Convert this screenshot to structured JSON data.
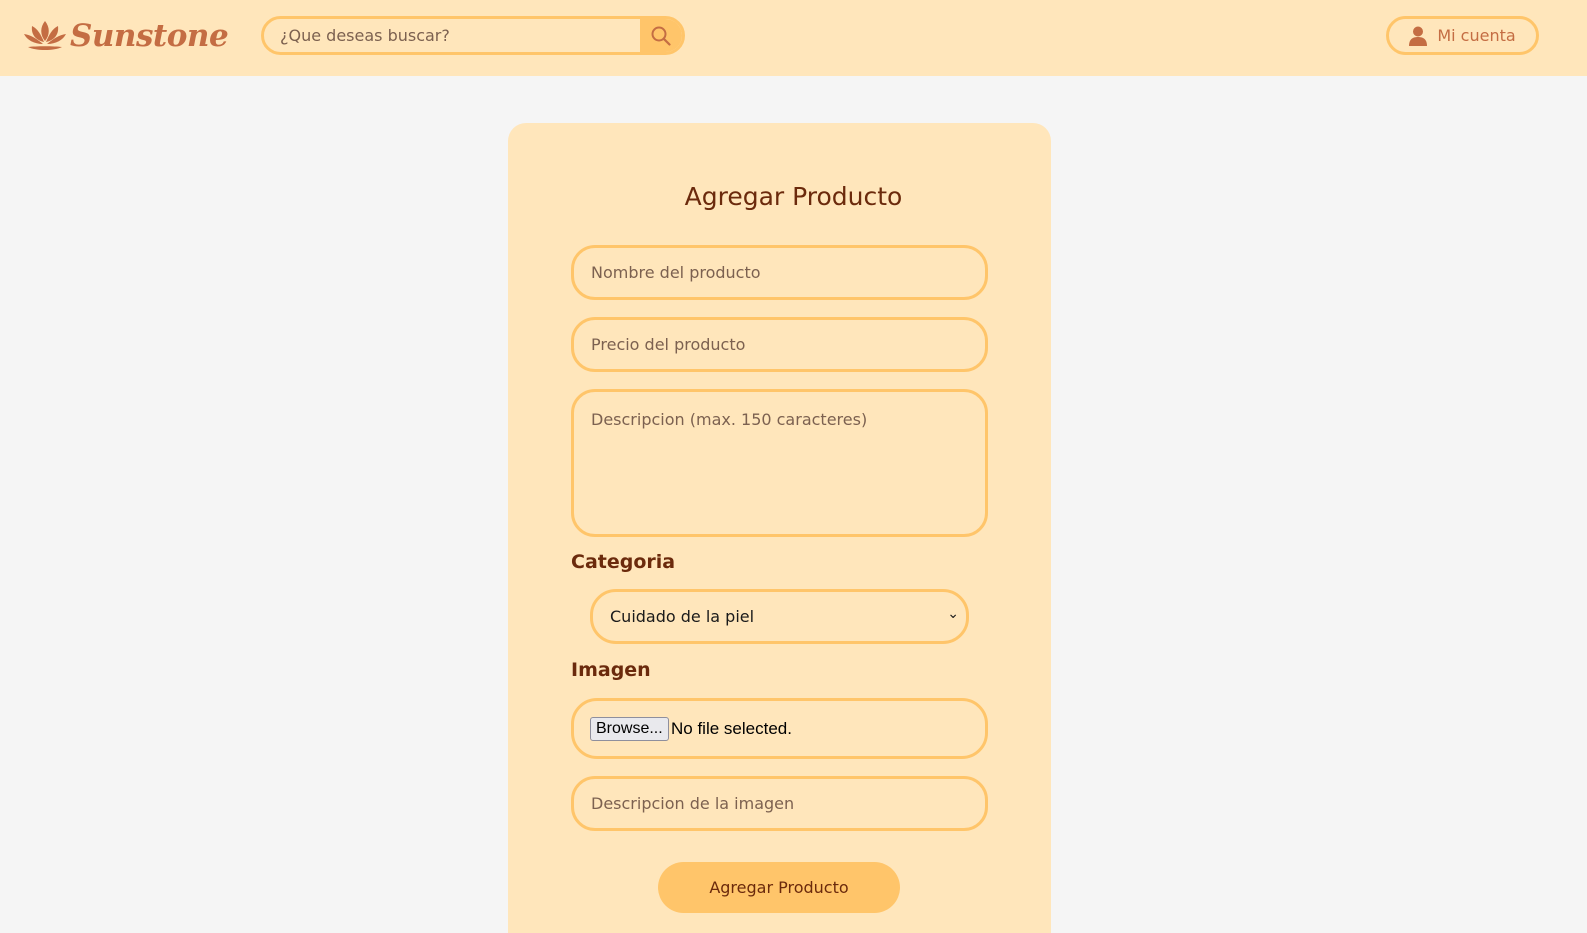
{
  "header": {
    "logo_text": "Sunstone",
    "logo_icon": "lotus-icon",
    "search": {
      "placeholder": "¿Que deseas buscar?",
      "value": "",
      "icon": "search-icon"
    },
    "account": {
      "label": "Mi cuenta",
      "icon": "user-icon"
    }
  },
  "form": {
    "title": "Agregar Producto",
    "name_field": {
      "placeholder": "Nombre del producto",
      "value": ""
    },
    "price_field": {
      "placeholder": "Precio del producto",
      "value": ""
    },
    "description_field": {
      "placeholder": "Descripcion (max. 150 caracteres)",
      "value": ""
    },
    "category": {
      "label": "Categoria",
      "selected": "Cuidado de la piel",
      "caret_icon": "chevron-down-icon"
    },
    "image": {
      "label": "Imagen",
      "browse_label": "Browse...",
      "file_status": "No file selected."
    },
    "image_description_field": {
      "placeholder": "Descripcion de la imagen",
      "value": ""
    },
    "submit_label": "Agregar Producto"
  },
  "colors": {
    "header_bg": "#ffe6bb",
    "page_bg": "#f5f5f5",
    "accent": "#ffc56a",
    "brand": "#c46d43",
    "text_dark": "#6b2a0c"
  }
}
